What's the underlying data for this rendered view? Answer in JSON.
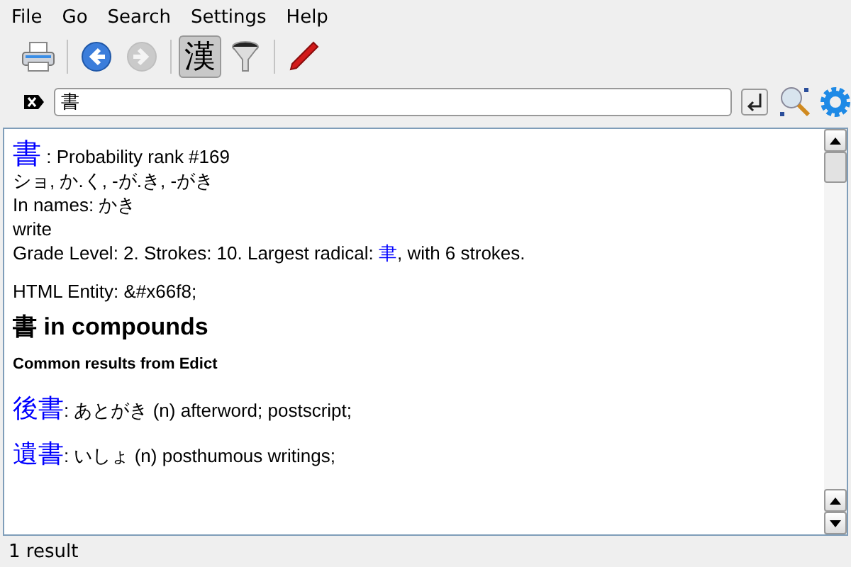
{
  "menu": [
    "File",
    "Go",
    "Search",
    "Settings",
    "Help"
  ],
  "toolbar": [
    {
      "kind": "print",
      "disabled": false,
      "selected": false
    },
    {
      "kind": "back",
      "disabled": false,
      "selected": false
    },
    {
      "kind": "forward",
      "disabled": true,
      "selected": false
    },
    {
      "kind": "kanji",
      "label": "漢",
      "disabled": false,
      "selected": true
    },
    {
      "kind": "filter",
      "disabled": false,
      "selected": false
    },
    {
      "kind": "edit",
      "disabled": false,
      "selected": false
    }
  ],
  "search": {
    "value": "書"
  },
  "result": {
    "kanji": "書",
    "rank": ": Probability rank #169",
    "readings": "ショ, か.く, -が.き, -がき",
    "names": "In names: かき",
    "meaning": "write",
    "grade_before": "Grade Level: 2. Strokes: 10. Largest radical: ",
    "radical": "聿",
    "grade_after": ", with 6 strokes.",
    "entity": "HTML Entity: &#x66f8;",
    "compounds_heading": "書 in compounds",
    "subheading": "Common results from Edict",
    "entries": [
      {
        "word": "後書",
        "gloss": ": あとがき (n) afterword; postscript;"
      },
      {
        "word": "遺書",
        "gloss": ": いしょ (n) posthumous writings;"
      }
    ]
  },
  "status_bar": "1 result"
}
